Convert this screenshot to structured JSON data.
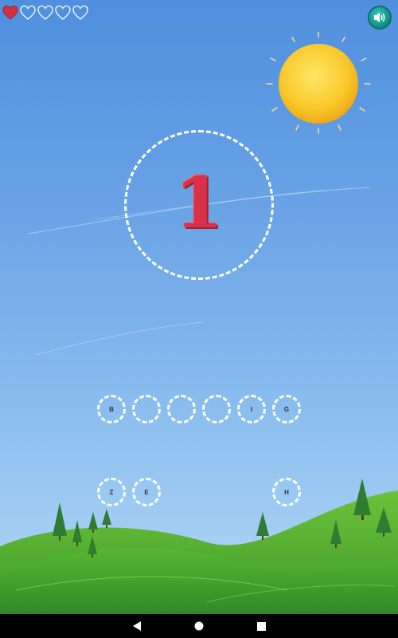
{
  "game": {
    "lives_total": 5,
    "lives_remaining": 1,
    "target": "1",
    "slots_row1": [
      "B",
      "",
      "",
      "",
      "I",
      "G"
    ],
    "slots_row2_left": [
      "Z",
      "E"
    ],
    "slots_row2_right": [
      "H"
    ]
  },
  "colors": {
    "heart_full": "#d9303f",
    "heart_empty_outline": "#ffffff",
    "number": "#d8324a",
    "sound_button": "#1aa89b",
    "sun": "#f7c21a"
  },
  "icons": {
    "sound": "speaker-icon",
    "nav_back": "triangle-back-icon",
    "nav_home": "circle-home-icon",
    "nav_recents": "square-recents-icon"
  }
}
